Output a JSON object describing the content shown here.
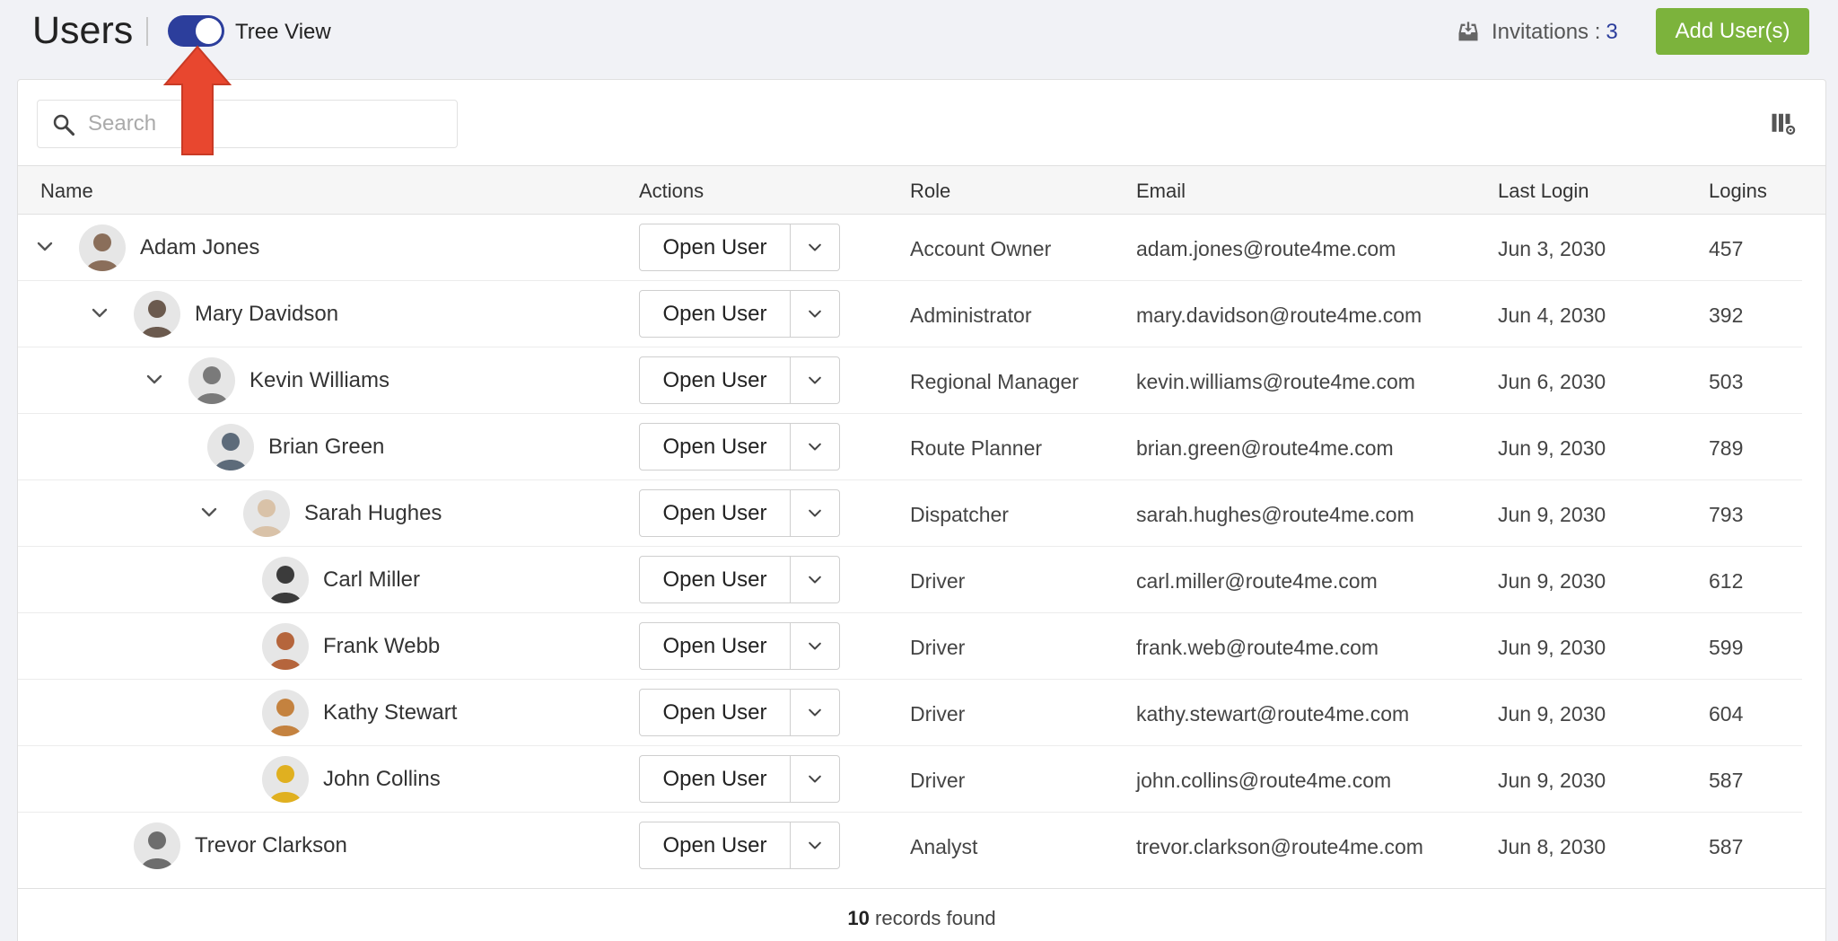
{
  "header": {
    "title": "Users",
    "toggle_label": "Tree View",
    "invitations_label": "Invitations :",
    "invitations_count": "3",
    "add_button": "Add User(s)"
  },
  "search": {
    "placeholder": "Search"
  },
  "columns": [
    "Name",
    "Actions",
    "Role",
    "Email",
    "Last Login",
    "Logins"
  ],
  "rows": [
    {
      "name": "Adam Jones",
      "level": 0,
      "expandable": true,
      "role": "Account Owner",
      "email": "adam.jones@route4me.com",
      "last_login": "Jun 3, 2030",
      "logins": "457",
      "action": "Open User"
    },
    {
      "name": "Mary Davidson",
      "level": 1,
      "expandable": true,
      "role": "Administrator",
      "email": "mary.davidson@route4me.com",
      "last_login": "Jun 4, 2030",
      "logins": "392",
      "action": "Open User"
    },
    {
      "name": "Kevin Williams",
      "level": 2,
      "expandable": true,
      "role": "Regional Manager",
      "email": "kevin.williams@route4me.com",
      "last_login": "Jun 6, 2030",
      "logins": "503",
      "action": "Open User"
    },
    {
      "name": "Brian Green",
      "level": 3,
      "expandable": false,
      "role": "Route Planner",
      "email": "brian.green@route4me.com",
      "last_login": "Jun 9, 2030",
      "logins": "789",
      "action": "Open User"
    },
    {
      "name": "Sarah Hughes",
      "level": 3,
      "expandable": true,
      "role": "Dispatcher",
      "email": "sarah.hughes@route4me.com",
      "last_login": "Jun 9, 2030",
      "logins": "793",
      "action": "Open User"
    },
    {
      "name": "Carl Miller",
      "level": 4,
      "expandable": false,
      "role": "Driver",
      "email": "carl.miller@route4me.com",
      "last_login": "Jun 9, 2030",
      "logins": "612",
      "action": "Open User"
    },
    {
      "name": "Frank Webb",
      "level": 4,
      "expandable": false,
      "role": "Driver",
      "email": "frank.web@route4me.com",
      "last_login": "Jun 9, 2030",
      "logins": "599",
      "action": "Open User"
    },
    {
      "name": "Kathy Stewart",
      "level": 4,
      "expandable": false,
      "role": "Driver",
      "email": "kathy.stewart@route4me.com",
      "last_login": "Jun 9, 2030",
      "logins": "604",
      "action": "Open User"
    },
    {
      "name": "John Collins",
      "level": 4,
      "expandable": false,
      "role": "Driver",
      "email": "john.collins@route4me.com",
      "last_login": "Jun 9, 2030",
      "logins": "587",
      "action": "Open User"
    },
    {
      "name": "Trevor Clarkson",
      "level": 1,
      "expandable": false,
      "role": "Analyst",
      "email": "trevor.clarkson@route4me.com",
      "last_login": "Jun 8, 2030",
      "logins": "587",
      "action": "Open User"
    }
  ],
  "footer": {
    "count": "10",
    "label": "records found"
  },
  "colors": {
    "accent": "#2c3e9c",
    "add_button": "#7cb33c",
    "arrow": "#e8472f"
  },
  "icons": [
    "inbox-download-icon",
    "search-icon",
    "column-settings-icon",
    "chevron-down-icon",
    "arrow-up-icon"
  ]
}
